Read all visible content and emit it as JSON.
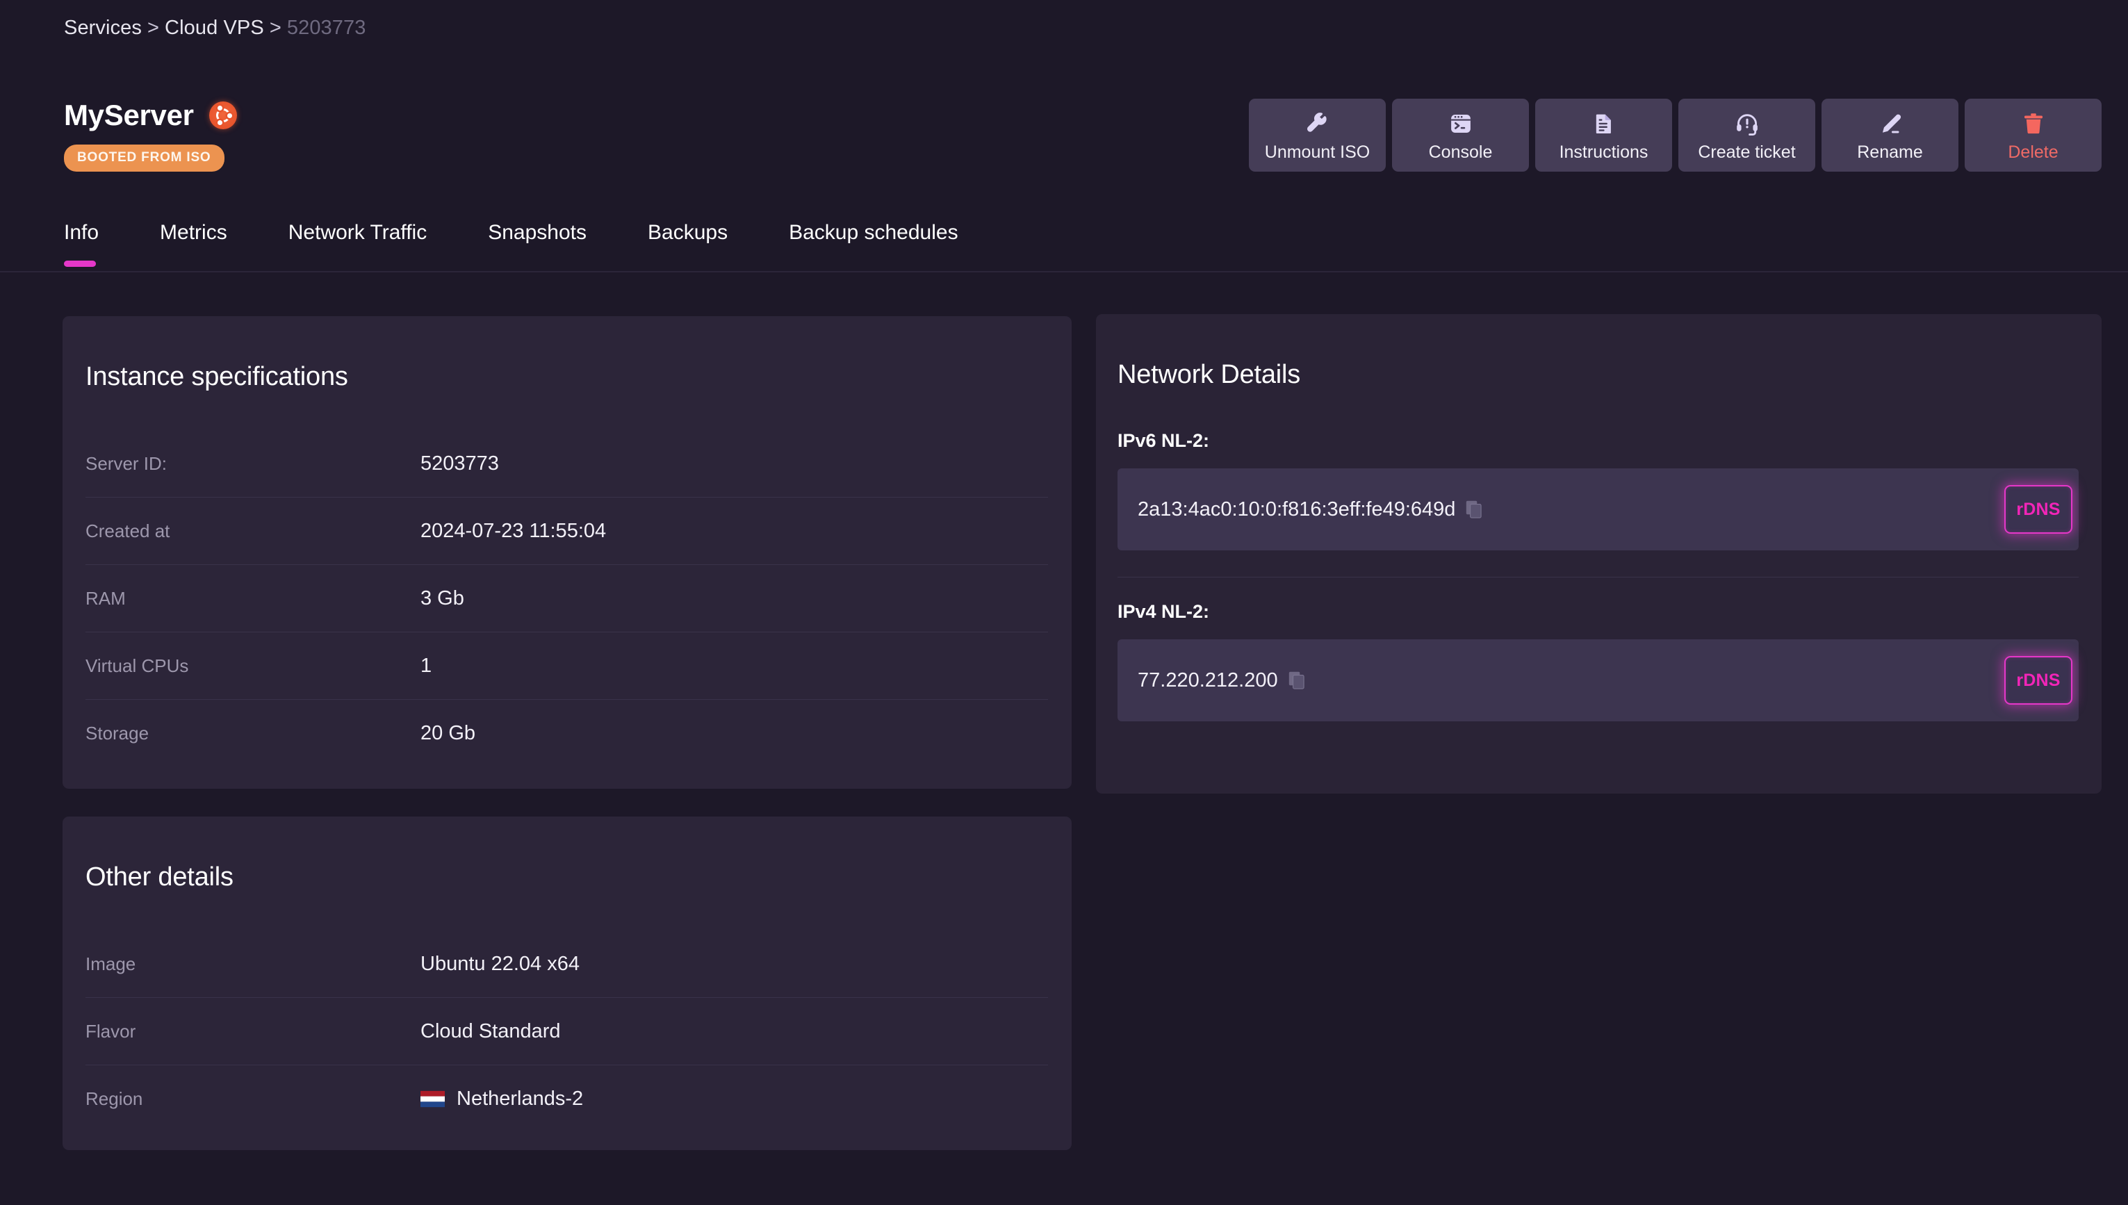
{
  "breadcrumb": {
    "items": [
      "Services",
      "Cloud VPS",
      "5203773"
    ],
    "separator": ">"
  },
  "header": {
    "server_name": "MyServer",
    "os_icon": "ubuntu-logo-icon",
    "status_badge": "BOOTED FROM ISO",
    "status_badge_color": "#ec9350"
  },
  "actions": [
    {
      "label": "Unmount ISO",
      "icon": "wrench-icon",
      "danger": false
    },
    {
      "label": "Console",
      "icon": "terminal-icon",
      "danger": false
    },
    {
      "label": "Instructions",
      "icon": "document-icon",
      "danger": false
    },
    {
      "label": "Create ticket",
      "icon": "headset-icon",
      "danger": false
    },
    {
      "label": "Rename",
      "icon": "pencil-icon",
      "danger": false
    },
    {
      "label": "Delete",
      "icon": "trash-icon",
      "danger": true
    }
  ],
  "tabs": [
    {
      "label": "Info",
      "active": true
    },
    {
      "label": "Metrics",
      "active": false
    },
    {
      "label": "Network Traffic",
      "active": false
    },
    {
      "label": "Snapshots",
      "active": false
    },
    {
      "label": "Backups",
      "active": false
    },
    {
      "label": "Backup schedules",
      "active": false
    }
  ],
  "active_tab_color": "#e537c8",
  "instance_specifications": {
    "title": "Instance specifications",
    "rows": [
      {
        "label": "Server ID:",
        "value": "5203773"
      },
      {
        "label": "Created at",
        "value": "2024-07-23 11:55:04"
      },
      {
        "label": "RAM",
        "value": "3 Gb"
      },
      {
        "label": "Virtual CPUs",
        "value": "1"
      },
      {
        "label": "Storage",
        "value": "20 Gb"
      }
    ]
  },
  "other_details": {
    "title": "Other details",
    "rows": [
      {
        "label": "Image",
        "value": "Ubuntu 22.04 x64",
        "flag": null
      },
      {
        "label": "Flavor",
        "value": "Cloud Standard",
        "flag": null
      },
      {
        "label": "Region",
        "value": "Netherlands-2",
        "flag": "netherlands-flag-icon"
      }
    ]
  },
  "network_details": {
    "title": "Network Details",
    "groups": [
      {
        "heading": "IPv6 NL-2:",
        "address": "2a13:4ac0:10:0:f816:3eff:fe49:649d",
        "copy_icon": "copy-icon",
        "rdns_label": "rDNS"
      },
      {
        "heading": "IPv4 NL-2:",
        "address": "77.220.212.200",
        "copy_icon": "copy-icon",
        "rdns_label": "rDNS"
      }
    ]
  }
}
